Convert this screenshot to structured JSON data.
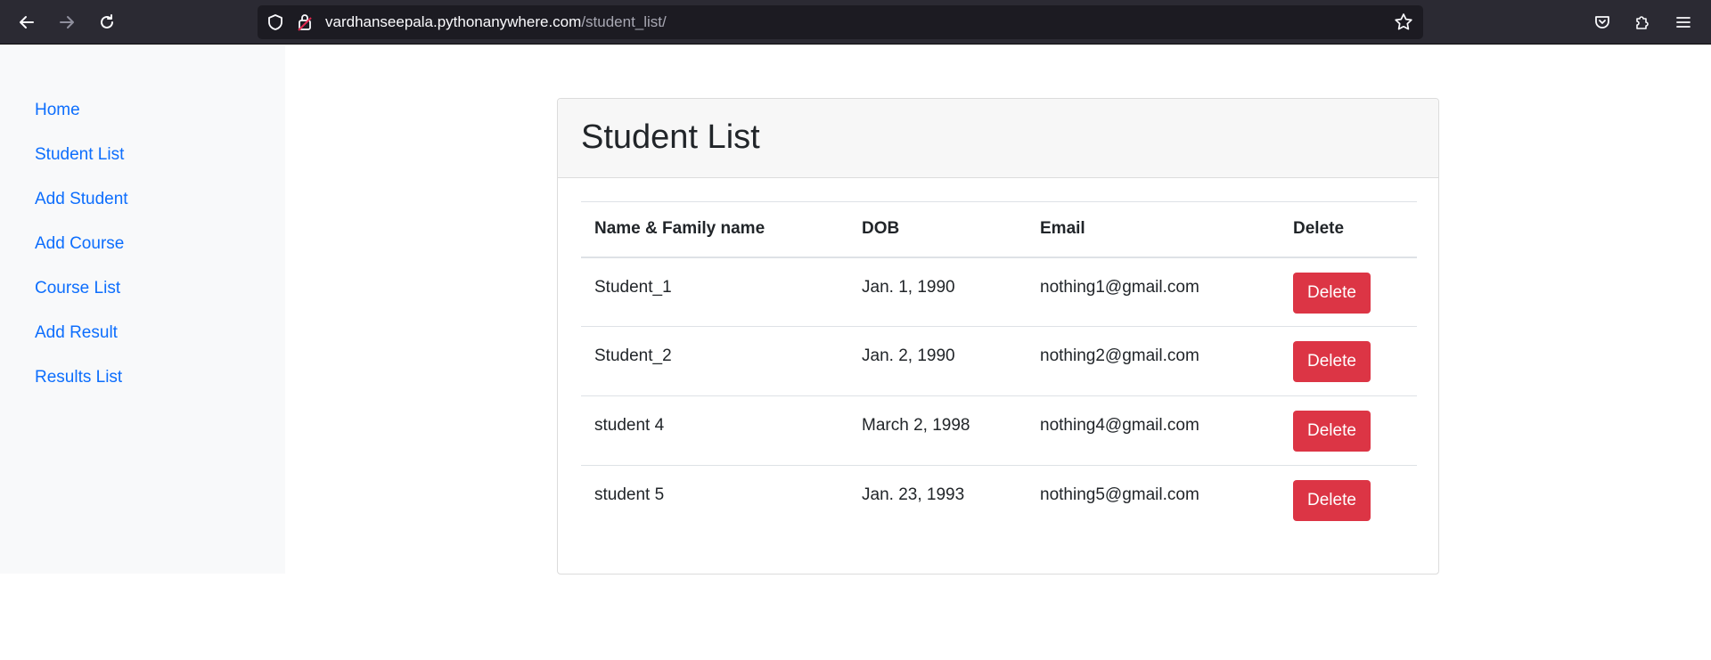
{
  "browser": {
    "url_host": "vardhanseepala.pythonanywhere.com",
    "url_path": "/student_list/"
  },
  "sidebar": {
    "items": [
      {
        "label": "Home"
      },
      {
        "label": "Student List"
      },
      {
        "label": "Add Student"
      },
      {
        "label": "Add Course"
      },
      {
        "label": "Course List"
      },
      {
        "label": "Add Result"
      },
      {
        "label": "Results List"
      }
    ]
  },
  "main": {
    "title": "Student List",
    "columns": [
      "Name & Family name",
      "DOB",
      "Email",
      "Delete"
    ],
    "rows": [
      {
        "name": "Student_1",
        "dob": "Jan. 1, 1990",
        "email": "nothing1@gmail.com",
        "action": "Delete"
      },
      {
        "name": "Student_2",
        "dob": "Jan. 2, 1990",
        "email": "nothing2@gmail.com",
        "action": "Delete"
      },
      {
        "name": "student 4",
        "dob": "March 2, 1998",
        "email": "nothing4@gmail.com",
        "action": "Delete"
      },
      {
        "name": "student 5",
        "dob": "Jan. 23, 1993",
        "email": "nothing5@gmail.com",
        "action": "Delete"
      }
    ]
  },
  "colors": {
    "link": "#0d6efd",
    "danger": "#dc3545",
    "toolbar": "#2b2a33",
    "urlbar": "#1c1b22"
  }
}
